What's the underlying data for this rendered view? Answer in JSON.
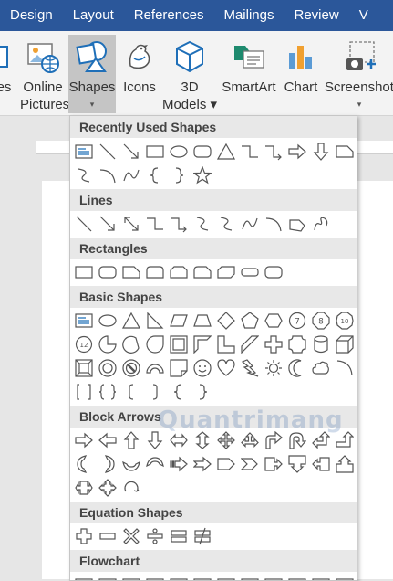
{
  "tabs": [
    "Design",
    "Layout",
    "References",
    "Mailings",
    "Review",
    "V"
  ],
  "ribbon": {
    "buttons": [
      {
        "name": "pictures-button",
        "label1": "res",
        "label2": "",
        "icon": "picture-icon",
        "caret": false
      },
      {
        "name": "online-pictures-button",
        "label1": "Online",
        "label2": "Pictures",
        "icon": "globe-picture-icon",
        "caret": false
      },
      {
        "name": "shapes-button",
        "label1": "Shapes",
        "label2": "▾",
        "icon": "shapes-icon",
        "caret": true,
        "active": true
      },
      {
        "name": "icons-button",
        "label1": "Icons",
        "label2": "",
        "icon": "bird-icon",
        "caret": false
      },
      {
        "name": "3d-models-button",
        "label1": "3D",
        "label2": "Models ▾",
        "icon": "cube-icon",
        "caret": true
      },
      {
        "name": "smartart-button",
        "label1": "SmartArt",
        "label2": "",
        "icon": "smartart-icon",
        "caret": false
      },
      {
        "name": "chart-button",
        "label1": "Chart",
        "label2": "",
        "icon": "bar-chart-icon",
        "caret": false
      },
      {
        "name": "screenshot-button",
        "label1": "Screenshot",
        "label2": "▾",
        "icon": "camera-icon",
        "caret": true
      }
    ]
  },
  "gallery": {
    "sections": [
      {
        "title": "Recently Used Shapes"
      },
      {
        "title": "Lines"
      },
      {
        "title": "Rectangles"
      },
      {
        "title": "Basic Shapes"
      },
      {
        "title": "Block Arrows"
      },
      {
        "title": "Equation Shapes"
      },
      {
        "title": "Flowchart"
      }
    ],
    "watermark": "Quantrimang"
  },
  "colors": {
    "accent": "#2b579a",
    "icon_blue": "#1f6fb8"
  }
}
